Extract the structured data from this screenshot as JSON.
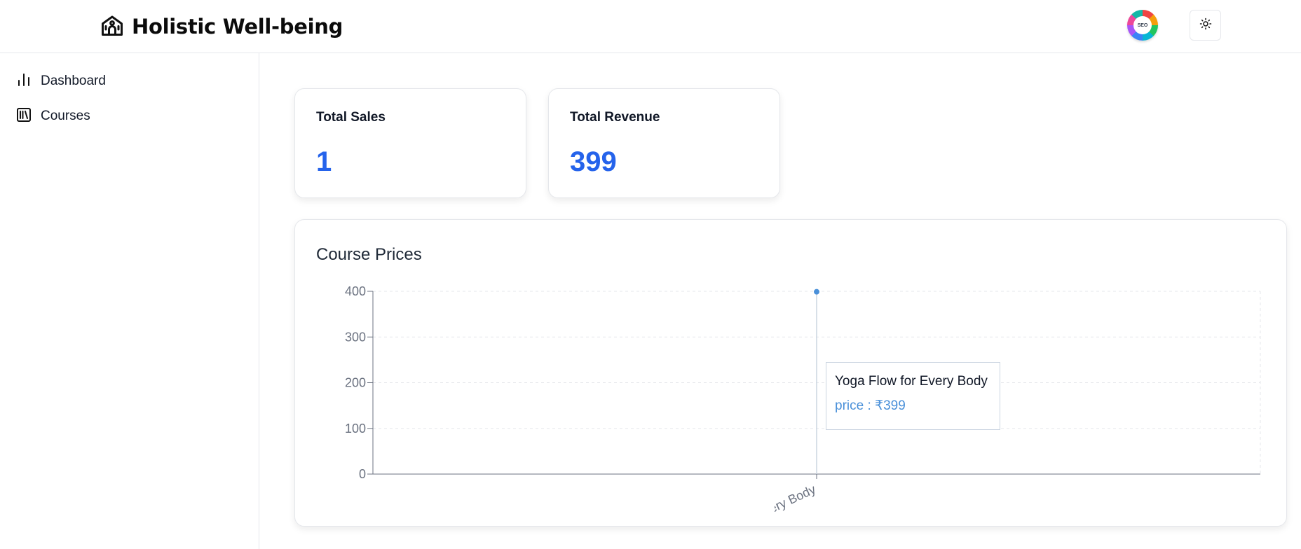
{
  "app": {
    "title": "Holistic Well-being"
  },
  "header": {
    "avatar_text": "SEO"
  },
  "sidebar": {
    "items": [
      {
        "label": "Dashboard",
        "icon": "bar-chart-icon"
      },
      {
        "label": "Courses",
        "icon": "library-icon"
      }
    ]
  },
  "stats": [
    {
      "title": "Total Sales",
      "value": "1"
    },
    {
      "title": "Total Revenue",
      "value": "399"
    }
  ],
  "chart": {
    "title": "Course Prices"
  },
  "tooltip": {
    "title": "Yoga Flow for Every Body",
    "value": "price : ₹399"
  },
  "colors": {
    "accent": "#2563eb",
    "series": "#4a90d9"
  },
  "chart_data": {
    "type": "line",
    "categories": [
      "Yoga Flow for Every Body"
    ],
    "series": [
      {
        "name": "price",
        "values": [
          399
        ]
      }
    ],
    "ylim": [
      0,
      400
    ],
    "yticks": [
      0,
      100,
      200,
      300,
      400
    ],
    "grid": true,
    "xlabel": "",
    "ylabel": ""
  }
}
